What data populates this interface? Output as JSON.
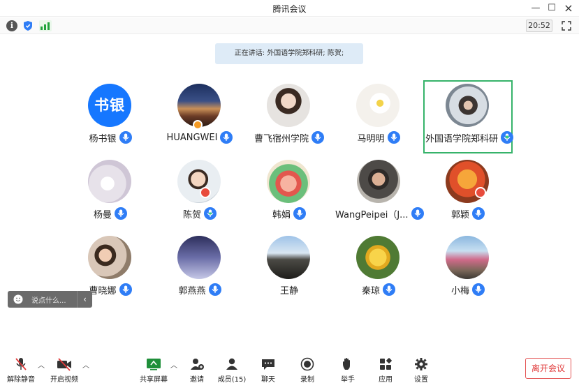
{
  "window": {
    "title": "腾讯会议"
  },
  "status": {
    "time": "20:52"
  },
  "speaking_banner": {
    "prefix": "正在讲话:",
    "names": "外国语学院郑科研; 陈贺;"
  },
  "participants": [
    {
      "name": "杨书银",
      "avatar_text": "书银",
      "mic": "on"
    },
    {
      "name": "HUANGWEI",
      "mic": "on"
    },
    {
      "name": "曹飞宿州学院",
      "mic": "on"
    },
    {
      "name": "马明明",
      "mic": "on"
    },
    {
      "name": "外国语学院郑科研",
      "mic": "speaking",
      "active": true
    },
    {
      "name": "杨曼",
      "mic": "on"
    },
    {
      "name": "陈贺",
      "mic": "speaking"
    },
    {
      "name": "韩娟",
      "mic": "on"
    },
    {
      "name": "WangPeipei（J...",
      "mic": "on"
    },
    {
      "name": "郭颖",
      "mic": "on"
    },
    {
      "name": "曹晓娜",
      "mic": "on"
    },
    {
      "name": "郭燕燕",
      "mic": "on"
    },
    {
      "name": "王静",
      "mic": "none"
    },
    {
      "name": "秦琼",
      "mic": "on"
    },
    {
      "name": "小梅",
      "mic": "on"
    }
  ],
  "chat_widget": {
    "placeholder": "说点什么..."
  },
  "toolbar": {
    "unmute": "解除静音",
    "start_video": "开启视频",
    "share_screen": "共享屏幕",
    "invite": "邀请",
    "members": "成员(15)",
    "chat": "聊天",
    "record": "录制",
    "raise_hand": "举手",
    "apps": "应用",
    "settings": "设置",
    "leave": "离开会议"
  },
  "colors": {
    "accent": "#1677ff",
    "speaking_mic": "#2f7df6",
    "active_border": "#36b36a",
    "leave": "#e03a3a",
    "banner_bg": "#deebf7"
  }
}
